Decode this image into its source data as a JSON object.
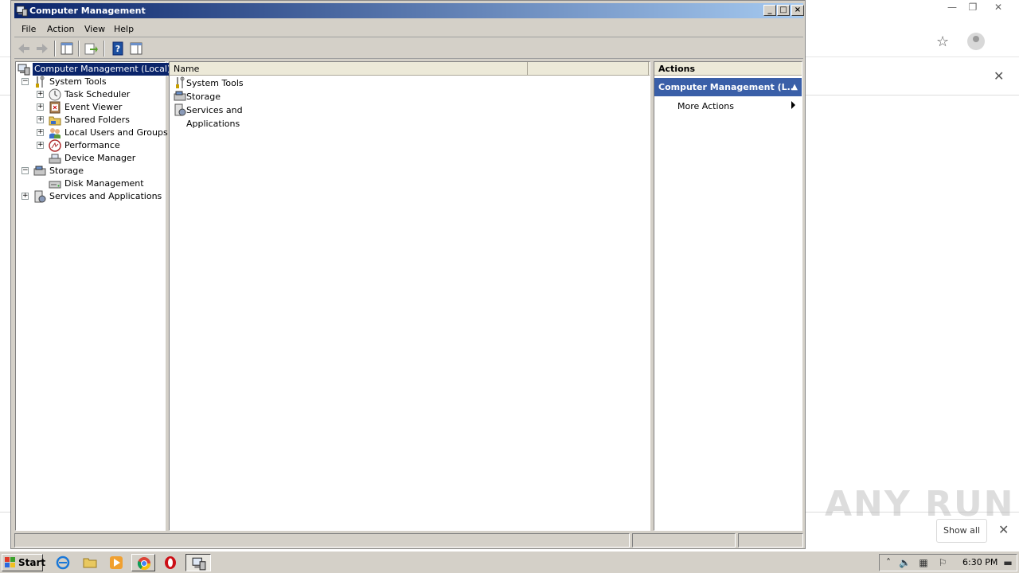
{
  "window": {
    "title": "Computer Management",
    "min": "_",
    "max": "□",
    "close": "×"
  },
  "menu": [
    "File",
    "Action",
    "View",
    "Help"
  ],
  "tree": {
    "root": "Computer Management (Local)",
    "items": [
      {
        "label": "System Tools",
        "icon": "tools-icon"
      },
      {
        "label": "Task Scheduler",
        "icon": "clock-icon"
      },
      {
        "label": "Event Viewer",
        "icon": "event-viewer-icon"
      },
      {
        "label": "Shared Folders",
        "icon": "shared-folder-icon"
      },
      {
        "label": "Local Users and Groups",
        "icon": "users-icon"
      },
      {
        "label": "Performance",
        "icon": "performance-icon"
      },
      {
        "label": "Device Manager",
        "icon": "device-manager-icon"
      },
      {
        "label": "Storage",
        "icon": "storage-icon"
      },
      {
        "label": "Disk Management",
        "icon": "disk-icon"
      },
      {
        "label": "Services and Applications",
        "icon": "services-icon"
      }
    ]
  },
  "list": {
    "column_name": "Name",
    "rows": [
      "System Tools",
      "Storage",
      "Services and Applications"
    ]
  },
  "actions": {
    "header": "Actions",
    "selected": "Computer Management (L...",
    "more": "More Actions"
  },
  "chrome": {
    "show_all": "Show all",
    "watermark": "ANY RUN"
  },
  "taskbar": {
    "start": "Start",
    "clock": "6:30 PM"
  },
  "colors": {
    "title_gradient_start": "#0a246a",
    "title_gradient_end": "#a6caf0",
    "actions_selected": "#3a5fa8",
    "selection": "#0a246a"
  }
}
